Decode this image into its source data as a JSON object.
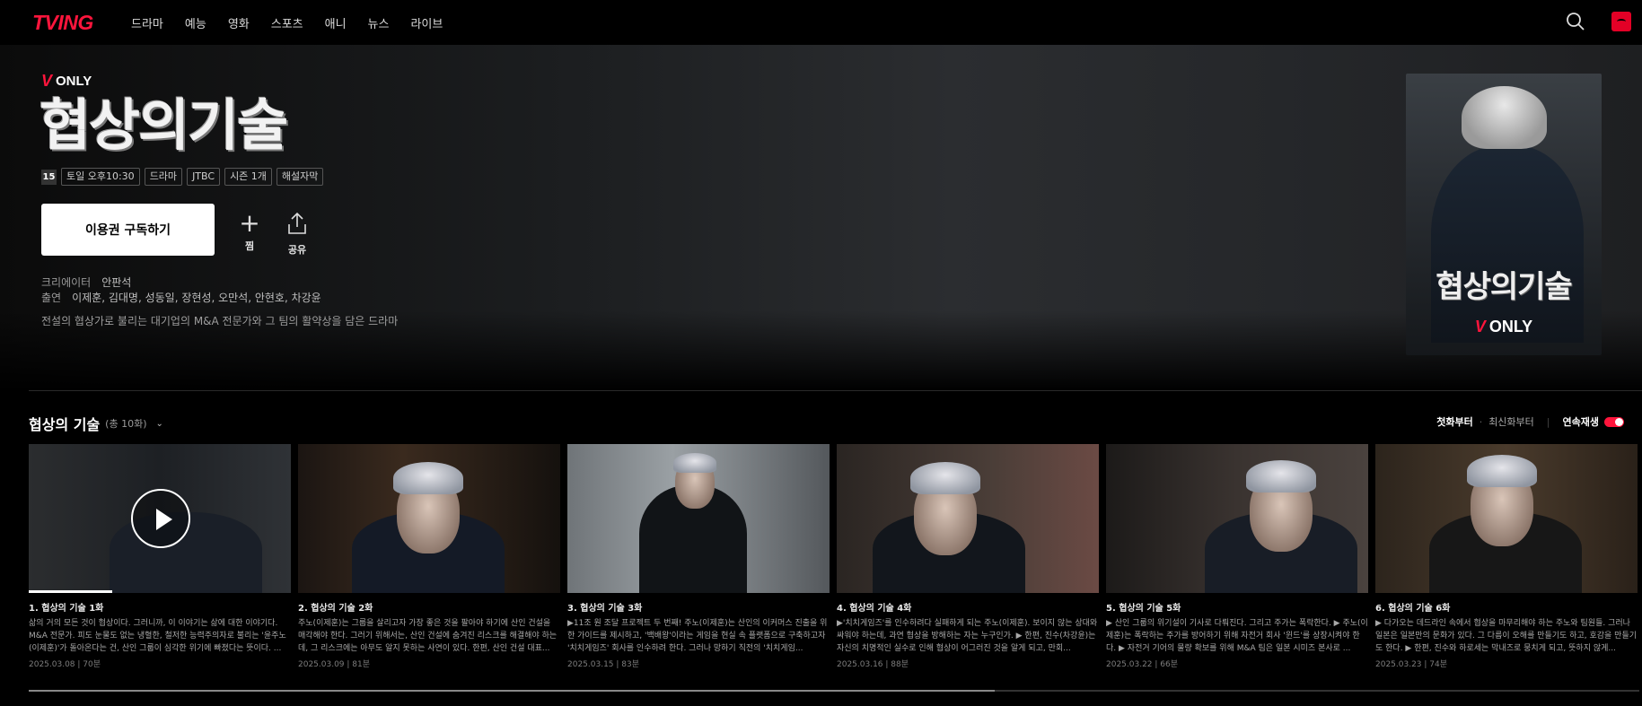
{
  "nav": {
    "logo": "TVING",
    "menu": [
      "드라마",
      "예능",
      "영화",
      "스포츠",
      "애니",
      "뉴스",
      "라이브"
    ],
    "icons": [
      "search-icon",
      "profile-icon"
    ]
  },
  "show": {
    "badge_mark": "V",
    "badge_text": "ONLY",
    "title": "협상의기술",
    "rating": "15",
    "tags": [
      "토일 오후10:30",
      "드라마",
      "JTBC",
      "시즌 1개",
      "해설자막"
    ],
    "subscribe_label": "이용권 구독하기",
    "wish_label": "찜",
    "share_label": "공유",
    "creator_key": "크리에이터",
    "creator": "안판석",
    "cast_key": "출연",
    "cast": "이제훈, 김대명, 성동일, 장현성, 오만석, 안현호, 차강윤",
    "synopsis": "전설의 협상가로 불리는 대기업의 M&A 전문가와 그 팀의 활약상을 담은 드라마"
  },
  "poster": {
    "title": "협상의기술",
    "mark": "V",
    "only": "ONLY"
  },
  "episodes": {
    "title": "협상의 기술",
    "count": "(총 10화)",
    "sort_first": "첫화부터",
    "sort_latest": "최신화부터",
    "autoplay": "연속재생",
    "autoplay_on": true,
    "watched_fraction": 0.32,
    "list_scroll_fraction": 0.6,
    "items": [
      {
        "name": "1. 협상의 기술 1화",
        "desc": "삶의 거의 모든 것이 협상이다. 그러니까, 이 이야기는 삶에 대한 이야기다. M&A 전문가. 피도 눈물도 없는 냉혈한, 철저한 능력주의자로 불리는 '윤주노(이제훈)'가 돌아온다는 건, 산인 그룹이 심각한 위기에 빠졌다는 뜻이다. ...",
        "date": "2025.03.08 | 70분"
      },
      {
        "name": "2. 협상의 기술 2화",
        "desc": "주노(이제훈)는 그룹을 살리고자 가장 좋은 것을 팔아야 하기에 산인 건설을 매각해야 한다. 그러기 위해서는, 산인 건설에 숨겨진 리스크를 해결해야 하는데, 그 리스크에는 아무도 알지 못하는 사연이 있다. 한편, 산인 건설 대표...",
        "date": "2025.03.09 | 81분"
      },
      {
        "name": "3. 협상의 기술 3화",
        "desc": "▶11조 원 조달 프로젝트 두 번째! 주노(이제훈)는 산인의 이커머스 진출을 위한 가이드를 제시하고, '백배왕'이라는 게임을 현실 속 플랫폼으로 구축하고자 '치치게임즈' 회사를 인수하려 한다. 그러나 망하기 직전의 '치치게임...",
        "date": "2025.03.15 | 83분"
      },
      {
        "name": "4. 협상의 기술 4화",
        "desc": "▶'치치게임즈'를 인수하려다 실패하게 되는 주노(이제훈). 보이지 않는 상대와 싸워야 하는데, 과연 협상을 방해하는 자는 누구인가. ▶ 한편, 진수(차강윤)는 자신의 치명적인 실수로 인해 협상이 어그러진 것을 알게 되고, 만회...",
        "date": "2025.03.16 | 88분"
      },
      {
        "name": "5. 협상의 기술 5화",
        "desc": "▶ 산인 그룹의 위기설이 기사로 다뤄진다. 그리고 주가는 폭락한다. ▶ 주노(이제훈)는 폭락하는 주가를 방어하기 위해 자전거 회사 '윈드'를 상장시켜야 한다. ▶ 자전거 기어의 물량 확보를 위해 M&A 팀은 일본 시미즈 본사로 ...",
        "date": "2025.03.22 | 66분"
      },
      {
        "name": "6. 협상의 기술 6화",
        "desc": "▶ 다가오는 데드라인 속에서 협상을 마무리해야 하는 주노와 팀원들. 그러나 일본은 일본만의 문화가 있다. 그 다름이 오해를 만들기도 하고, 호감을 만들기도 한다. ▶ 한편, 진수와 하로세는 막내즈로 뭉치게 되고, 뜻하지 않게...",
        "date": "2025.03.23 | 74분"
      }
    ]
  },
  "colors": {
    "brand": "#ff153c",
    "background": "#000000"
  }
}
